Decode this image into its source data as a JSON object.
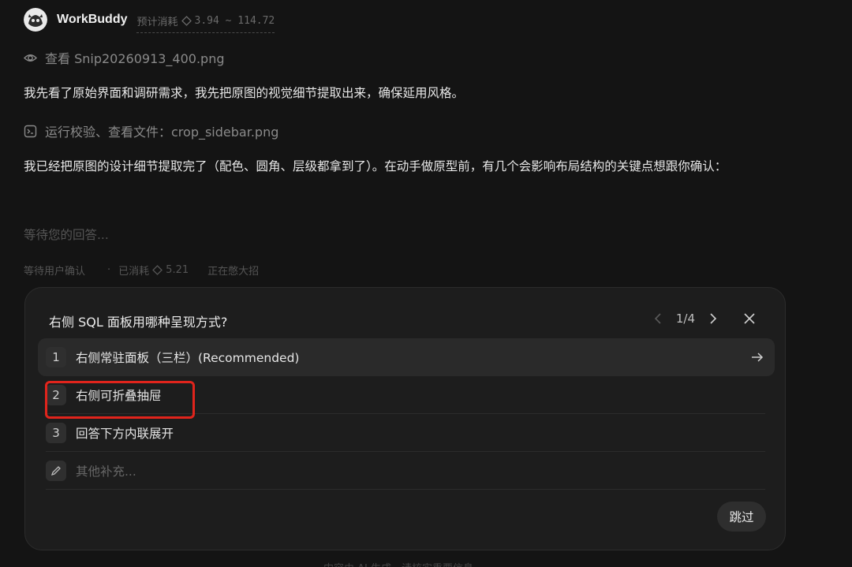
{
  "header": {
    "app_name": "WorkBuddy",
    "cost_label": "预计消耗",
    "cost_range": "3.94 ~ 114.72"
  },
  "activities": [
    {
      "icon": "eye-icon",
      "text": "查看 Snip20260913_400.png"
    },
    {
      "icon": "terminal-icon",
      "text": "运行校验、查看文件：crop_sidebar.png"
    }
  ],
  "messages": [
    "我先看了原始界面和调研需求，我先把原图的视觉细节提取出来，确保延用风格。",
    "我已经把原图的设计细节提取完了（配色、圆角、层级都拿到了）。在动手做原型前，有几个会影响布局结构的关键点想跟你确认："
  ],
  "waiting_text": "等待您的回答...",
  "status": {
    "state": "等待用户确认",
    "spent_label": "已消耗",
    "spent_value": "5.21",
    "activity": "正在憋大招"
  },
  "question": {
    "title": "右侧 SQL 面板用哪种呈现方式?",
    "page": "1/4",
    "options": [
      {
        "num": "1",
        "label": "右侧常驻面板（三栏）(Recommended)"
      },
      {
        "num": "2",
        "label": "右侧可折叠抽屉"
      },
      {
        "num": "3",
        "label": "回答下方内联展开"
      }
    ],
    "other_placeholder": "其他补充...",
    "skip_label": "跳过"
  },
  "footer_text": "内容由 AI 生成，请核实重要信息",
  "colors": {
    "highlight": "#e0241c",
    "background": "#141414",
    "card": "#1d1d1d"
  }
}
